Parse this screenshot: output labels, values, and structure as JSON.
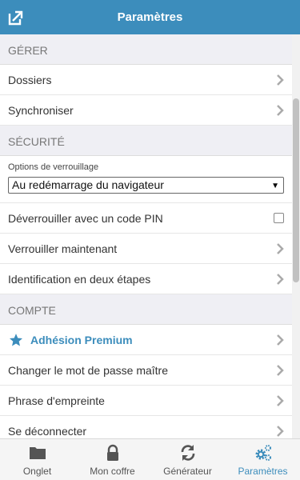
{
  "header": {
    "title": "Paramètres"
  },
  "sections": {
    "manage": {
      "title": "GÉRER",
      "folders": "Dossiers",
      "sync": "Synchroniser"
    },
    "security": {
      "title": "SÉCURITÉ",
      "lock_options_label": "Options de verrouillage",
      "lock_options_value": "Au redémarrage du navigateur",
      "unlock_pin": "Déverrouiller avec un code PIN",
      "lock_now": "Verrouiller maintenant",
      "two_step": "Identification en deux étapes"
    },
    "account": {
      "title": "COMPTE",
      "premium": "Adhésion Premium",
      "change_master": "Changer le mot de passe maître",
      "fingerprint": "Phrase d'empreinte",
      "partial_row": "Se déconnecter"
    }
  },
  "tabbar": {
    "tabs": [
      {
        "label": "Onglet",
        "icon": "folder-icon"
      },
      {
        "label": "Mon coffre",
        "icon": "lock-icon"
      },
      {
        "label": "Générateur",
        "icon": "refresh-icon"
      },
      {
        "label": "Paramètres",
        "icon": "gears-icon",
        "active": true
      }
    ]
  },
  "colors": {
    "accent": "#3c8dbc",
    "background": "#efeff4"
  }
}
